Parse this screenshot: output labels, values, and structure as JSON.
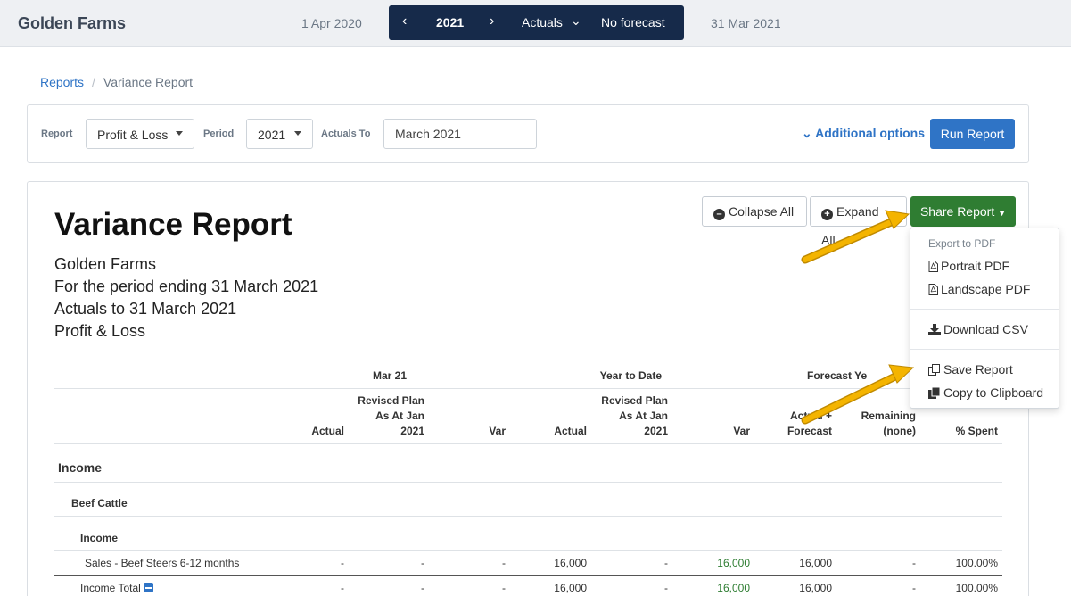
{
  "topbar": {
    "brand": "Golden Farms",
    "date_start": "1 Apr 2020",
    "date_end": "31 Mar 2021",
    "year": "2021",
    "prev_icon": "chevron-left-icon",
    "next_icon": "chevron-right-icon",
    "actuals": "Actuals",
    "forecast": "No forecast"
  },
  "breadcrumb": {
    "link": "Reports",
    "separator": "/",
    "current": "Variance Report"
  },
  "filters": {
    "report_label": "Report",
    "report_value": "Profit & Loss",
    "period_label": "Period",
    "period_value": "2021",
    "actuals_to_label": "Actuals To",
    "actuals_to_value": "March 2021",
    "additional_options": "Additional options",
    "run_button": "Run Report"
  },
  "report": {
    "title": "Variance Report",
    "subtitle_lines": [
      "Golden Farms",
      "For the period ending 31 March 2021",
      "Actuals to 31 March 2021",
      "Profit & Loss"
    ],
    "collapse_all": "Collapse All",
    "expand_all": "Expand All",
    "share": "Share Report"
  },
  "share_menu": {
    "header": "Export to PDF",
    "portrait": "Portrait PDF",
    "landscape": "Landscape PDF",
    "csv": "Download CSV",
    "save": "Save Report",
    "clipboard": "Copy to Clipboard"
  },
  "table": {
    "groups": {
      "month": "Mar 21",
      "ytd": "Year to Date",
      "forecast": "Forecast Ye"
    },
    "columns": {
      "actual": "Actual",
      "revised_plan": "Revised Plan\nAs At Jan\n2021",
      "var": "Var",
      "actual_forecast": "Actual +\nForecast",
      "remaining": "Remaining\n(none)",
      "spent": "% Spent"
    },
    "section": "Income",
    "subsection": "Beef Cattle",
    "group": "Income",
    "rows": [
      {
        "label": "Sales - Beef Steers 6-12 months",
        "values": [
          "-",
          "-",
          "-",
          "16,000",
          "-",
          "16,000",
          "16,000",
          "-",
          "100.00%"
        ]
      },
      {
        "label": "Income Total",
        "values": [
          "-",
          "-",
          "-",
          "16,000",
          "-",
          "16,000",
          "16,000",
          "-",
          "100.00%"
        ]
      }
    ]
  },
  "colors": {
    "navy": "#162a4a",
    "primary": "#2f74c6",
    "share_green": "#2f7d32",
    "arrow": "#f4b400"
  }
}
